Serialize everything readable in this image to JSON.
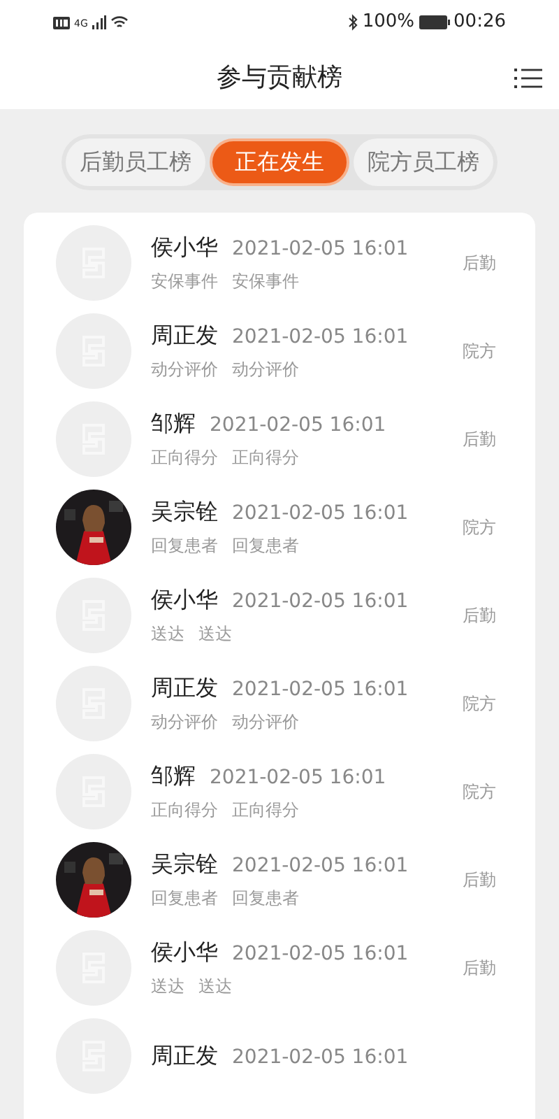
{
  "status_bar": {
    "network": "4G",
    "battery": "100%",
    "time": "00:26"
  },
  "header": {
    "title": "参与贡献榜"
  },
  "tabs": [
    {
      "label": "后勤员工榜",
      "selected": false
    },
    {
      "label": "正在发生",
      "selected": true
    },
    {
      "label": "院方员工榜",
      "selected": false
    }
  ],
  "entries": [
    {
      "kind": "placeholder",
      "name": "侯小华",
      "time": "2021-02-05 16:01",
      "tags": [
        "安保事件",
        "安保事件"
      ],
      "badge": "后勤"
    },
    {
      "kind": "placeholder",
      "name": "周正发",
      "time": "2021-02-05 16:01",
      "tags": [
        "动分评价",
        "动分评价"
      ],
      "badge": "院方"
    },
    {
      "kind": "placeholder",
      "name": "邹辉",
      "time": "2021-02-05 16:01",
      "tags": [
        "正向得分",
        "正向得分"
      ],
      "badge": "后勤"
    },
    {
      "kind": "picture",
      "name": "吴宗铨",
      "time": "2021-02-05 16:01",
      "tags": [
        "回复患者",
        "回复患者"
      ],
      "badge": "院方"
    },
    {
      "kind": "placeholder",
      "name": "侯小华",
      "time": "2021-02-05 16:01",
      "tags": [
        "送达",
        "送达"
      ],
      "badge": "后勤"
    },
    {
      "kind": "placeholder",
      "name": "周正发",
      "time": "2021-02-05 16:01",
      "tags": [
        "动分评价",
        "动分评价"
      ],
      "badge": "院方"
    },
    {
      "kind": "placeholder",
      "name": "邹辉",
      "time": "2021-02-05 16:01",
      "tags": [
        "正向得分",
        "正向得分"
      ],
      "badge": "院方"
    },
    {
      "kind": "picture",
      "name": "吴宗铨",
      "time": "2021-02-05 16:01",
      "tags": [
        "回复患者",
        "回复患者"
      ],
      "badge": "后勤"
    },
    {
      "kind": "placeholder",
      "name": "侯小华",
      "time": "2021-02-05 16:01",
      "tags": [
        "送达",
        "送达"
      ],
      "badge": "后勤"
    },
    {
      "kind": "placeholder",
      "name": "周正发",
      "time": "2021-02-05 16:01"
    }
  ]
}
